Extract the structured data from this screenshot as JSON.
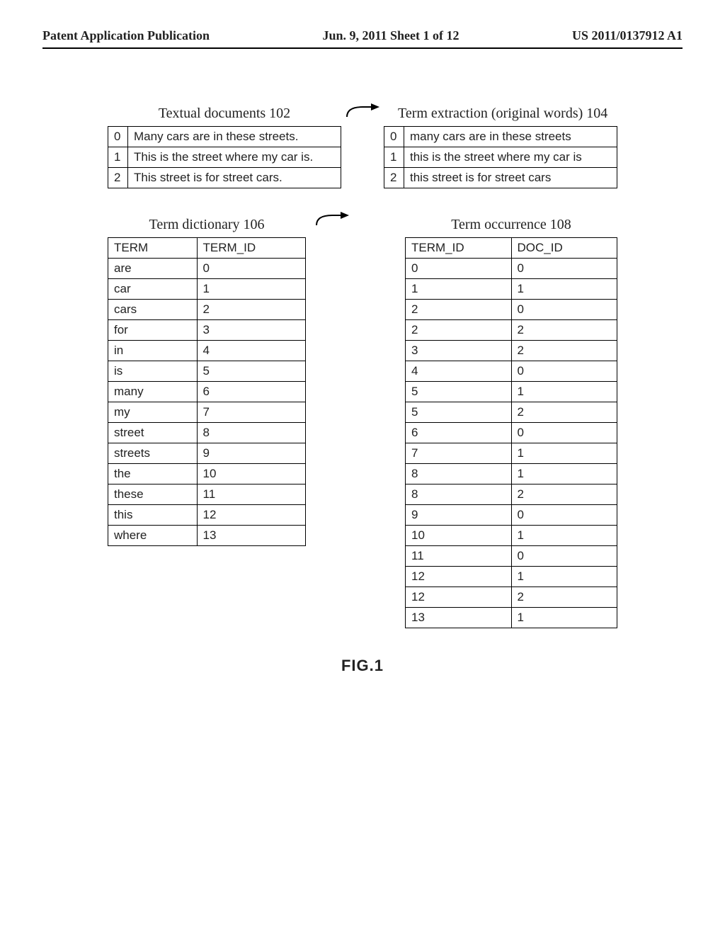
{
  "header": {
    "left": "Patent Application Publication",
    "center": "Jun. 9, 2011   Sheet 1 of 12",
    "right": "US 2011/0137912 A1"
  },
  "textualDocs": {
    "title": "Textual documents 102",
    "rows": [
      {
        "num": "0",
        "text": "Many cars are in these streets."
      },
      {
        "num": "1",
        "text": "This is the street where my car is."
      },
      {
        "num": "2",
        "text": "This street is for street cars."
      }
    ]
  },
  "termExtraction": {
    "title": "Term extraction (original words) 104",
    "rows": [
      {
        "num": "0",
        "text": "many cars are in these streets"
      },
      {
        "num": "1",
        "text": "this is the street where my car is"
      },
      {
        "num": "2",
        "text": "this street is for street cars"
      }
    ]
  },
  "termDictionary": {
    "title": "Term dictionary 106",
    "headers": {
      "c1": "TERM",
      "c2": "TERM_ID"
    },
    "rows": [
      {
        "c1": "are",
        "c2": "0"
      },
      {
        "c1": "car",
        "c2": "1"
      },
      {
        "c1": "cars",
        "c2": "2"
      },
      {
        "c1": "for",
        "c2": "3"
      },
      {
        "c1": "in",
        "c2": "4"
      },
      {
        "c1": "is",
        "c2": "5"
      },
      {
        "c1": "many",
        "c2": "6"
      },
      {
        "c1": "my",
        "c2": "7"
      },
      {
        "c1": "street",
        "c2": "8"
      },
      {
        "c1": "streets",
        "c2": "9"
      },
      {
        "c1": "the",
        "c2": "10"
      },
      {
        "c1": "these",
        "c2": "11"
      },
      {
        "c1": "this",
        "c2": "12"
      },
      {
        "c1": "where",
        "c2": "13"
      }
    ]
  },
  "termOccurrence": {
    "title": "Term occurrence 108",
    "headers": {
      "c1": "TERM_ID",
      "c2": "DOC_ID"
    },
    "rows": [
      {
        "c1": "0",
        "c2": "0"
      },
      {
        "c1": "1",
        "c2": "1"
      },
      {
        "c1": "2",
        "c2": "0"
      },
      {
        "c1": "2",
        "c2": "2"
      },
      {
        "c1": "3",
        "c2": "2"
      },
      {
        "c1": "4",
        "c2": "0"
      },
      {
        "c1": "5",
        "c2": "1"
      },
      {
        "c1": "5",
        "c2": "2"
      },
      {
        "c1": "6",
        "c2": "0"
      },
      {
        "c1": "7",
        "c2": "1"
      },
      {
        "c1": "8",
        "c2": "1"
      },
      {
        "c1": "8",
        "c2": "2"
      },
      {
        "c1": "9",
        "c2": "0"
      },
      {
        "c1": "10",
        "c2": "1"
      },
      {
        "c1": "11",
        "c2": "0"
      },
      {
        "c1": "12",
        "c2": "1"
      },
      {
        "c1": "12",
        "c2": "2"
      },
      {
        "c1": "13",
        "c2": "1"
      }
    ]
  },
  "figLabel": "FIG.1"
}
